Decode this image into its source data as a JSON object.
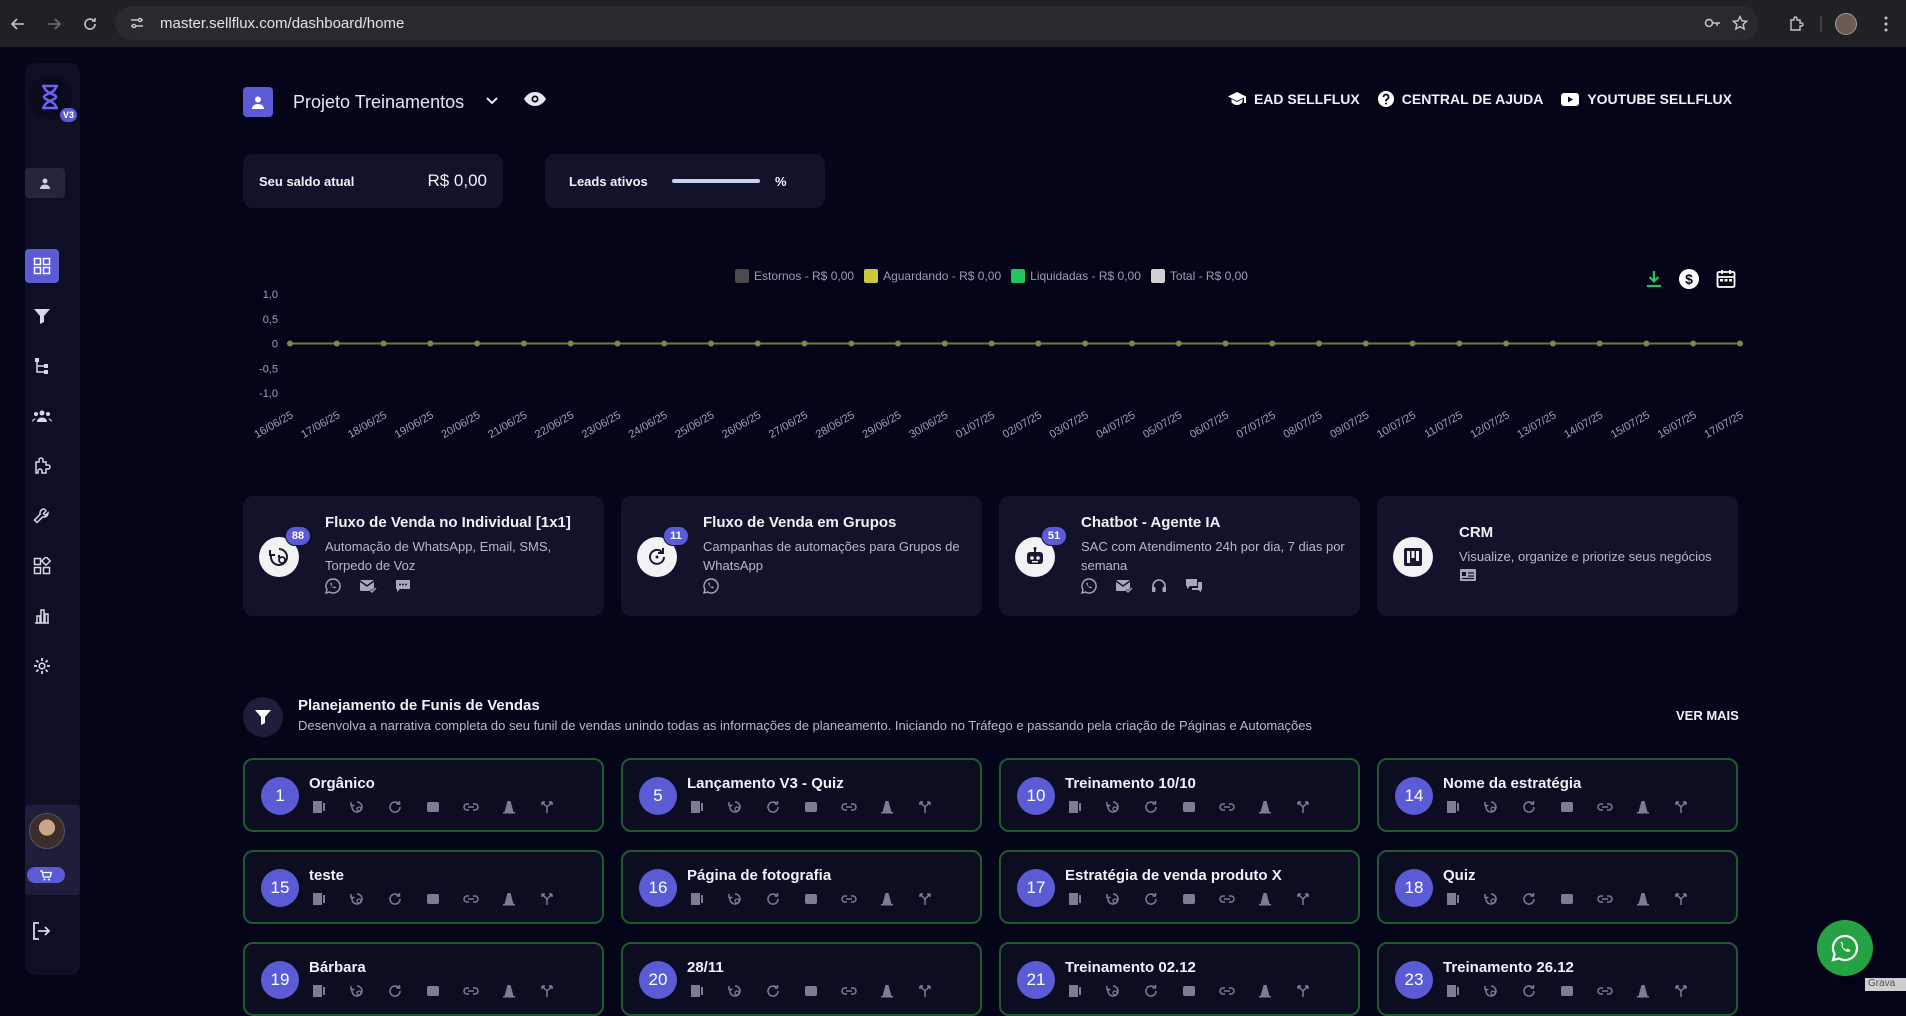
{
  "browser": {
    "url": "master.sellflux.com/dashboard/home"
  },
  "sidebar": {
    "logo_badge": "V3"
  },
  "header": {
    "project_name": "Projeto Treinamentos",
    "links": [
      {
        "label": "EAD SELLFLUX",
        "icon": "graduation-cap-icon"
      },
      {
        "label": "CENTRAL DE AJUDA",
        "icon": "help-circle-icon"
      },
      {
        "label": "YOUTUBE SELLFLUX",
        "icon": "youtube-icon"
      }
    ]
  },
  "stats": {
    "balance_label": "Seu saldo atual",
    "balance_value": "R$ 0,00",
    "leads_label": "Leads ativos",
    "leads_unit": "%"
  },
  "colors": {
    "accent": "#5b5bd6",
    "background": "#05051a",
    "card": "#12122a",
    "funnel_border": "#1f5a2e",
    "whatsapp": "#25a244"
  },
  "chart_data": {
    "type": "line",
    "x": [
      "16/06/25",
      "17/06/25",
      "18/06/25",
      "19/06/25",
      "20/06/25",
      "21/06/25",
      "22/06/25",
      "23/06/25",
      "24/06/25",
      "25/06/25",
      "26/06/25",
      "27/06/25",
      "28/06/25",
      "29/06/25",
      "30/06/25",
      "01/07/25",
      "02/07/25",
      "03/07/25",
      "04/07/25",
      "05/07/25",
      "06/07/25",
      "07/07/25",
      "08/07/25",
      "09/07/25",
      "10/07/25",
      "11/07/25",
      "12/07/25",
      "13/07/25",
      "14/07/25",
      "15/07/25",
      "16/07/25",
      "17/07/25"
    ],
    "series": [
      {
        "name": "Estornos - R$ 0,00",
        "color": "#4a4a4a",
        "values": [
          0,
          0,
          0,
          0,
          0,
          0,
          0,
          0,
          0,
          0,
          0,
          0,
          0,
          0,
          0,
          0,
          0,
          0,
          0,
          0,
          0,
          0,
          0,
          0,
          0,
          0,
          0,
          0,
          0,
          0,
          0,
          0
        ]
      },
      {
        "name": "Aguardando - R$ 0,00",
        "color": "#c8c83a",
        "values": [
          0,
          0,
          0,
          0,
          0,
          0,
          0,
          0,
          0,
          0,
          0,
          0,
          0,
          0,
          0,
          0,
          0,
          0,
          0,
          0,
          0,
          0,
          0,
          0,
          0,
          0,
          0,
          0,
          0,
          0,
          0,
          0
        ]
      },
      {
        "name": "Liquidadas - R$ 0,00",
        "color": "#22c55e",
        "values": [
          0,
          0,
          0,
          0,
          0,
          0,
          0,
          0,
          0,
          0,
          0,
          0,
          0,
          0,
          0,
          0,
          0,
          0,
          0,
          0,
          0,
          0,
          0,
          0,
          0,
          0,
          0,
          0,
          0,
          0,
          0,
          0
        ]
      },
      {
        "name": "Total - R$ 0,00",
        "color": "#d0d0d0",
        "values": [
          0,
          0,
          0,
          0,
          0,
          0,
          0,
          0,
          0,
          0,
          0,
          0,
          0,
          0,
          0,
          0,
          0,
          0,
          0,
          0,
          0,
          0,
          0,
          0,
          0,
          0,
          0,
          0,
          0,
          0,
          0,
          0
        ]
      }
    ],
    "y_ticks": [
      "1,0",
      "0,5",
      "0",
      "-0,5",
      "-1,0"
    ],
    "ylim": [
      -1,
      1
    ],
    "legend": "top-center",
    "grid": false
  },
  "products": [
    {
      "title": "Fluxo de Venda no Individual [1x1]",
      "desc": "Automação de WhatsApp, Email, SMS, Torpedo de Voz",
      "badge": "88",
      "icon": "individual-flow-icon",
      "channels": [
        "whatsapp-icon",
        "email-icon",
        "sms-icon"
      ]
    },
    {
      "title": "Fluxo de Venda em Grupos",
      "desc": "Campanhas de automações para Grupos de WhatsApp",
      "badge": "11",
      "icon": "group-flow-icon",
      "channels": [
        "whatsapp-icon"
      ]
    },
    {
      "title": "Chatbot - Agente IA",
      "desc": "SAC com Atendimento 24h por dia, 7 dias por semana",
      "badge": "51",
      "icon": "robot-icon",
      "channels": [
        "whatsapp-icon",
        "email-icon",
        "headset-icon",
        "chat-icon"
      ]
    },
    {
      "title": "CRM",
      "desc": "Visualize, organize e priorize seus negócios",
      "badge": "",
      "icon": "kanban-icon",
      "channels": [
        "id-card-icon"
      ]
    }
  ],
  "funnels_section": {
    "title": "Planejamento de Funis de Vendas",
    "desc": "Desenvolva a narrativa completa do seu funil de vendas unindo todas as informações de planeamento. Iniciando no Tráfego e passando pela criação de Páginas e Automações",
    "more": "VER MAIS"
  },
  "funnels": [
    {
      "num": "1",
      "name": "Orgânico"
    },
    {
      "num": "5",
      "name": "Lançamento V3 - Quiz"
    },
    {
      "num": "10",
      "name": "Treinamento 10/10"
    },
    {
      "num": "14",
      "name": "Nome da estratégia"
    },
    {
      "num": "15",
      "name": "teste"
    },
    {
      "num": "16",
      "name": "Página de fotografia"
    },
    {
      "num": "17",
      "name": "Estratégia de venda produto X"
    },
    {
      "num": "18",
      "name": "Quiz"
    },
    {
      "num": "19",
      "name": "Bárbara"
    },
    {
      "num": "20",
      "name": "28/11"
    },
    {
      "num": "21",
      "name": "Treinamento 02.12"
    },
    {
      "num": "23",
      "name": "Treinamento 26.12"
    }
  ],
  "corner_tag": "Grava"
}
